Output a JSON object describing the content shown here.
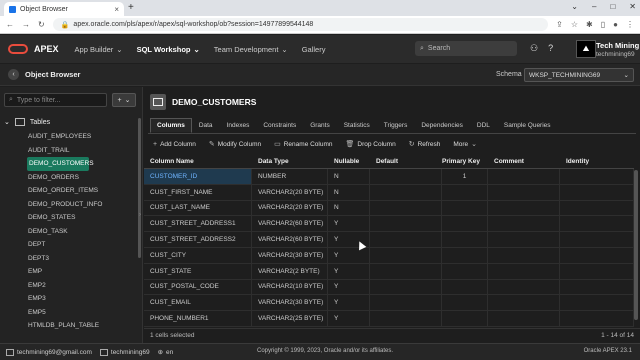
{
  "browser": {
    "tab_title": "Object Browser",
    "url": "apex.oracle.com/pls/apex/r/apex/sql-workshop/ob?session=14977899544148"
  },
  "header": {
    "app_name": "APEX",
    "nav": [
      {
        "label": "App Builder",
        "active": false
      },
      {
        "label": "SQL Workshop",
        "active": true
      },
      {
        "label": "Team Development",
        "active": false
      },
      {
        "label": "Gallery",
        "active": false
      }
    ],
    "search_placeholder": "Search",
    "user_name": "Tech Mining",
    "user_id": "techmining69"
  },
  "object_browser": {
    "title": "Object Browser",
    "schema_label": "Schema",
    "schema_value": "WKSP_TECHMINING69"
  },
  "sidebar": {
    "filter_placeholder": "Type to filter...",
    "add_label": "+",
    "section": "Tables",
    "tables": [
      "AUDIT_EMPLOYEES",
      "AUDIT_TRAIL",
      "DEMO_CUSTOMERS",
      "DEMO_ORDERS",
      "DEMO_ORDER_ITEMS",
      "DEMO_PRODUCT_INFO",
      "DEMO_STATES",
      "DEMO_TASK",
      "DEPT",
      "DEPT3",
      "EMP",
      "EMP2",
      "EMP3",
      "EMP5",
      "HTMLDB_PLAN_TABLE"
    ],
    "selected_index": 2
  },
  "main": {
    "object_name": "DEMO_CUSTOMERS",
    "tabs": [
      "Columns",
      "Data",
      "Indexes",
      "Constraints",
      "Grants",
      "Statistics",
      "Triggers",
      "Dependencies",
      "DDL",
      "Sample Queries"
    ],
    "toolbar": [
      "Add Column",
      "Modify Column",
      "Rename Column",
      "Drop Column",
      "Refresh",
      "More"
    ],
    "columns_header": [
      "Column Name",
      "Data Type",
      "Nullable",
      "Default",
      "Primary Key",
      "Comment",
      "Identity"
    ],
    "rows": [
      [
        "CUSTOMER_ID",
        "NUMBER",
        "N",
        "",
        "1",
        "",
        ""
      ],
      [
        "CUST_FIRST_NAME",
        "VARCHAR2(20 BYTE)",
        "N",
        "",
        "",
        "",
        ""
      ],
      [
        "CUST_LAST_NAME",
        "VARCHAR2(20 BYTE)",
        "N",
        "",
        "",
        "",
        ""
      ],
      [
        "CUST_STREET_ADDRESS1",
        "VARCHAR2(60 BYTE)",
        "Y",
        "",
        "",
        "",
        ""
      ],
      [
        "CUST_STREET_ADDRESS2",
        "VARCHAR2(60 BYTE)",
        "Y",
        "",
        "",
        "",
        ""
      ],
      [
        "CUST_CITY",
        "VARCHAR2(30 BYTE)",
        "Y",
        "",
        "",
        "",
        ""
      ],
      [
        "CUST_STATE",
        "VARCHAR2(2 BYTE)",
        "Y",
        "",
        "",
        "",
        ""
      ],
      [
        "CUST_POSTAL_CODE",
        "VARCHAR2(10 BYTE)",
        "Y",
        "",
        "",
        "",
        ""
      ],
      [
        "CUST_EMAIL",
        "VARCHAR2(30 BYTE)",
        "Y",
        "",
        "",
        "",
        ""
      ],
      [
        "PHONE_NUMBER1",
        "VARCHAR2(25 BYTE)",
        "Y",
        "",
        "",
        "",
        ""
      ]
    ],
    "footer_left": "1 cells selected",
    "footer_right": "1 - 14 of 14"
  },
  "statusbar": {
    "email": "techmining69@gmail.com",
    "workspace": "techmining69",
    "lang": "en",
    "copyright": "Copyright © 1999, 2023, Oracle and/or its affiliates.",
    "version": "Oracle APEX 23.1"
  }
}
